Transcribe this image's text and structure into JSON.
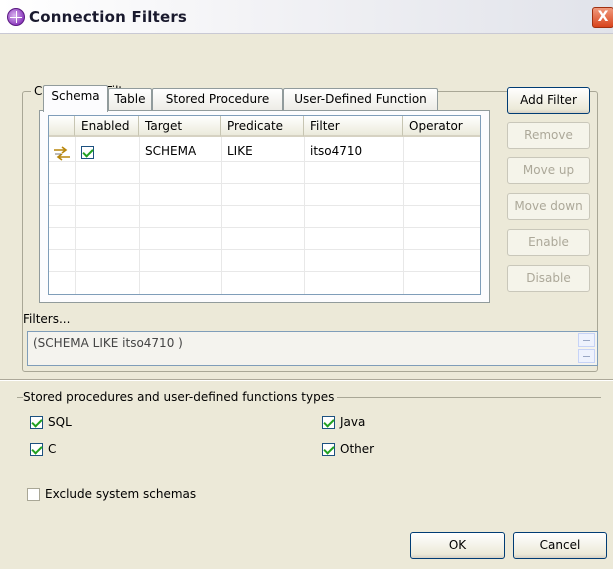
{
  "window": {
    "title": "Connection Filters",
    "close_label": "X"
  },
  "group": {
    "legend": "Connection Filters"
  },
  "tabs": [
    {
      "label": "Schema",
      "active": true
    },
    {
      "label": "Table",
      "active": false
    },
    {
      "label": "Stored Procedure",
      "active": false
    },
    {
      "label": "User-Defined Function",
      "active": false
    }
  ],
  "table": {
    "columns": [
      "",
      "Enabled",
      "Target",
      "Predicate",
      "Filter",
      "Operator"
    ],
    "rows": [
      {
        "enabled": true,
        "target": "SCHEMA",
        "predicate": "LIKE",
        "filter": "itso4710",
        "operator": ""
      }
    ]
  },
  "side_buttons": {
    "add_filter": "Add Filter",
    "remove": "Remove",
    "move_up": "Move up",
    "move_down": "Move down",
    "enable": "Enable",
    "disable": "Disable"
  },
  "filters": {
    "label": "Filters...",
    "value": "(SCHEMA LIKE itso4710 )"
  },
  "types": {
    "legend": "Stored procedures and user-defined functions types",
    "sql": {
      "label": "SQL",
      "checked": true
    },
    "c": {
      "label": "C",
      "checked": true
    },
    "java": {
      "label": "Java",
      "checked": true
    },
    "other": {
      "label": "Other",
      "checked": true
    }
  },
  "exclude_system_schemas": {
    "label": "Exclude system schemas",
    "checked": false
  },
  "footer": {
    "ok": "OK",
    "cancel": "Cancel"
  },
  "colors": {
    "dialog_bg": "#ece9d8",
    "button_border": "#003c74",
    "disabled_text": "#aca899"
  }
}
